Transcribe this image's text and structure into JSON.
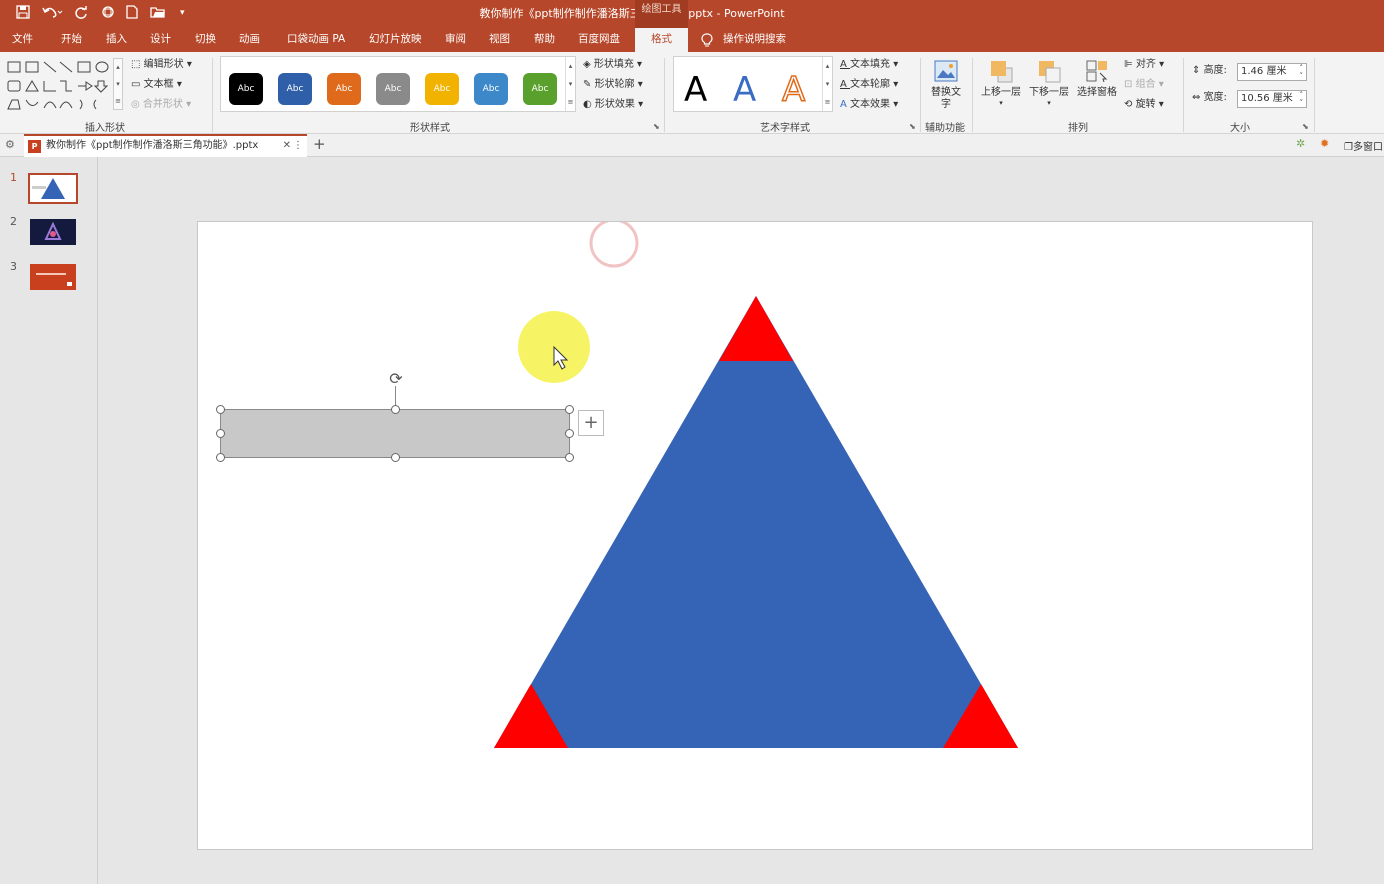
{
  "window": {
    "title": "教你制作《ppt制作制作潘洛斯三角功能》.pptx - PowerPoint",
    "context_tab_group": "绘图工具"
  },
  "quick_access": [
    "save-icon",
    "undo-icon",
    "redo-icon",
    "touch-mode-icon",
    "new-file-icon",
    "open-file-icon",
    "customize-icon"
  ],
  "ribbon_tabs": [
    "文件",
    "开始",
    "插入",
    "设计",
    "切换",
    "动画",
    "口袋动画 PA",
    "幻灯片放映",
    "审阅",
    "视图",
    "帮助",
    "百度网盘",
    "格式"
  ],
  "active_tab": "格式",
  "tell_me": "操作说明搜索",
  "groups": {
    "insert_shapes": {
      "label": "插入形状",
      "edit_shape": "编辑形状",
      "text_box": "文本框",
      "merge_shapes": "合并形状"
    },
    "shape_styles": {
      "label": "形状样式",
      "swatch_text": "Abc",
      "swatches": [
        "#000000",
        "#2f5fa8",
        "#e06a1b",
        "#8a8a8a",
        "#f2b200",
        "#3d88c9",
        "#5aa02c"
      ],
      "fill": "形状填充",
      "outline": "形状轮廓",
      "effects": "形状效果"
    },
    "wordart": {
      "label": "艺术字样式",
      "sample": "A",
      "fill": "文本填充",
      "outline": "文本轮廓",
      "effects": "文本效果"
    },
    "accessibility": {
      "label": "辅助功能",
      "alt_text": "替换文字"
    },
    "arrange": {
      "label": "排列",
      "bring_forward": "上移一层",
      "send_backward": "下移一层",
      "selection_pane": "选择窗格",
      "align": "对齐",
      "group": "组合",
      "rotate": "旋转"
    },
    "size": {
      "label": "大小",
      "height_label": "高度:",
      "height_value": "1.46 厘米",
      "width_label": "宽度:",
      "width_value": "10.56 厘米"
    }
  },
  "document_tab": {
    "name": "教你制作《ppt制作制作潘洛斯三角功能》.pptx",
    "multi_window": "多窗口"
  },
  "slides": [
    "1",
    "2",
    "3"
  ],
  "colors": {
    "accent": "#b7472a",
    "triangle_blue": "#3563b5",
    "triangle_red": "#ff0000",
    "selected_rect": "#c8c8c8",
    "cursor_highlight": "#f4f14a"
  }
}
